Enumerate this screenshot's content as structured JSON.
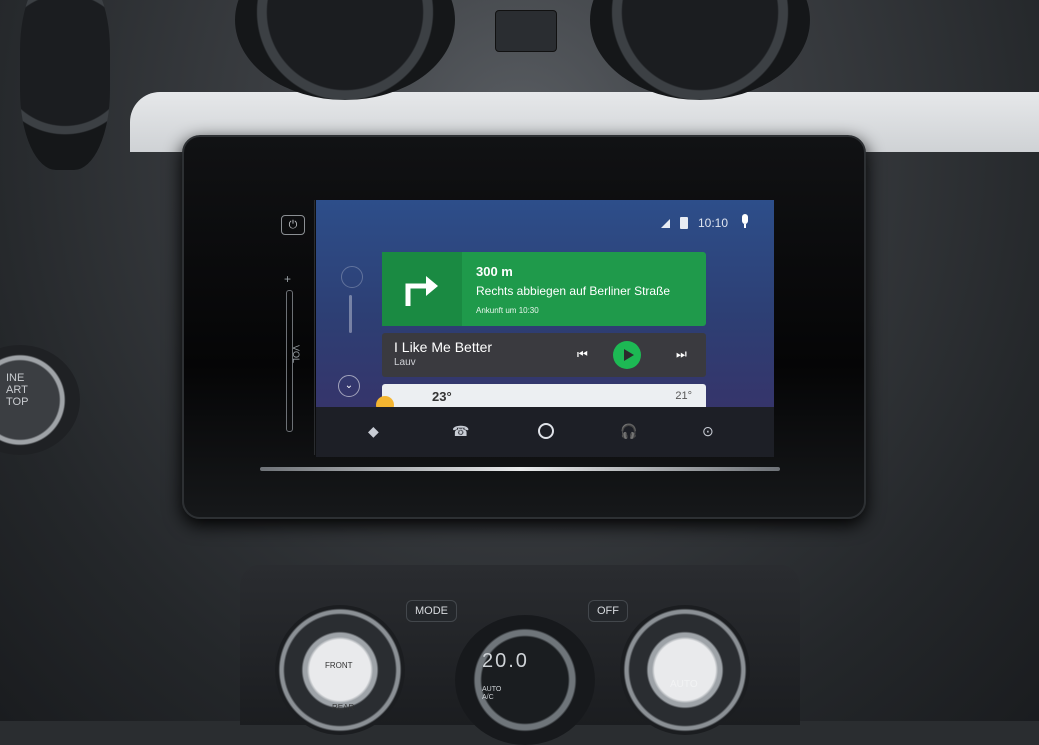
{
  "status": {
    "time": "10:10"
  },
  "navigation": {
    "distance": "300 m",
    "instruction": "Rechts abbiegen auf Berliner Straße",
    "eta": "Ankunft um 10:30"
  },
  "media": {
    "song": "I Like Me Better",
    "artist": "Lauv"
  },
  "weather": {
    "temp_left": "23°",
    "temp_right": "21°"
  },
  "head_unit": {
    "volume_label": "VOL"
  },
  "start_button": {
    "line1": "INE",
    "line2": "ART",
    "line3": "TOP"
  },
  "climate": {
    "mode_label": "MODE",
    "off_label": "OFF",
    "front_label": "FRONT",
    "rear_label": "REAR",
    "auto_label": "AUTO",
    "lcd_temp": "20.0",
    "lcd_small": "AUTO\nA/C"
  },
  "colors": {
    "nav_green": "#1f9a4b",
    "play_green": "#1db954",
    "screen_blue": "#2d4e8a"
  }
}
